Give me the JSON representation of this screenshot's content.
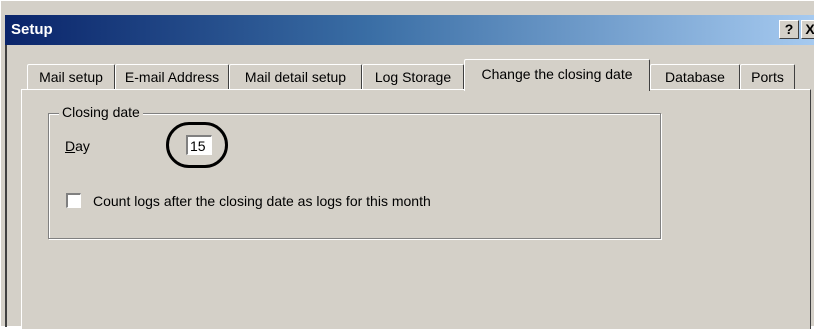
{
  "window": {
    "title": "Setup",
    "help_label": "?",
    "close_label": "X"
  },
  "tabs": [
    {
      "label": "Mail setup"
    },
    {
      "label": "E-mail Address"
    },
    {
      "label": "Mail detail setup"
    },
    {
      "label": "Log Storage"
    },
    {
      "label": "Change the closing date",
      "active": true
    },
    {
      "label": "Database"
    },
    {
      "label": "Ports"
    }
  ],
  "closing_date": {
    "group_title": "Closing date",
    "day_label_rest": "ay",
    "day_label_accel": "D",
    "day_value": "15",
    "checkbox_label": "Count logs after the closing date as logs for this month",
    "checkbox_checked": false
  }
}
